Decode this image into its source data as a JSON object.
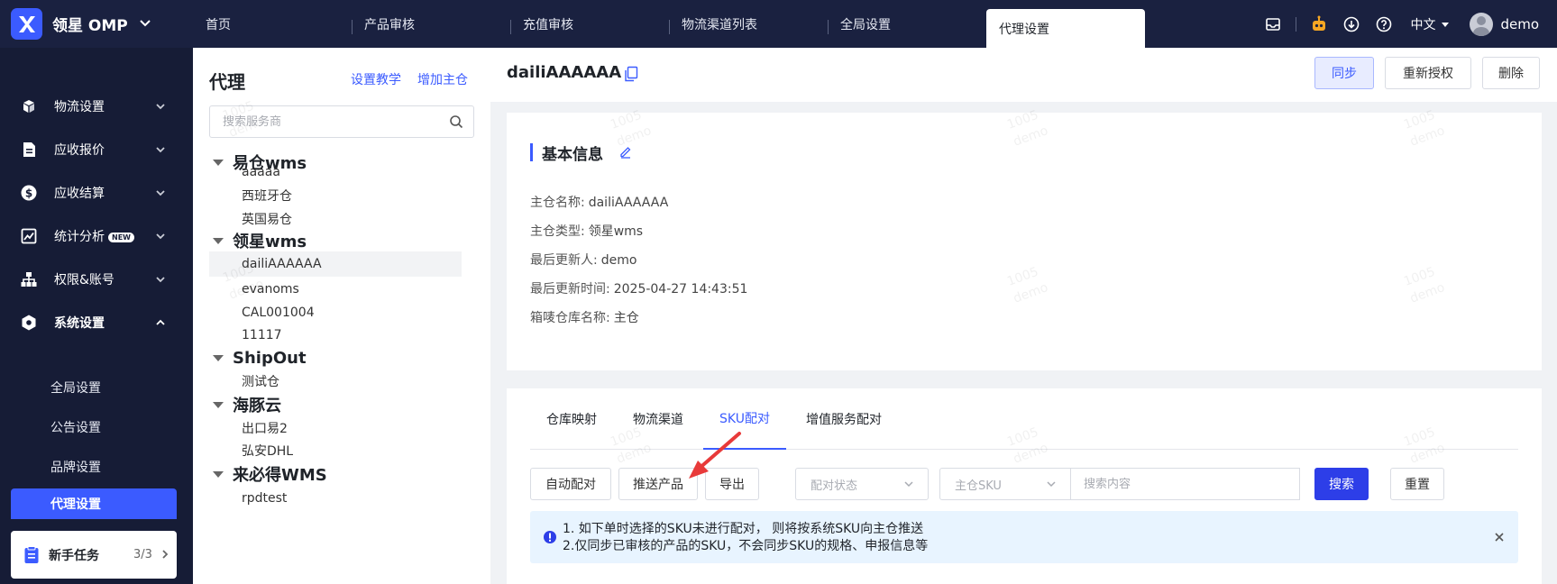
{
  "app": {
    "name": "领星 OMP"
  },
  "nav_tabs": [
    {
      "label": "首页"
    },
    {
      "label": "产品审核"
    },
    {
      "label": "充值审核"
    },
    {
      "label": "物流渠道列表"
    },
    {
      "label": "全局设置"
    },
    {
      "label": "代理设置",
      "active": true
    }
  ],
  "topbar": {
    "language": "中文",
    "username": "demo"
  },
  "sidebar": {
    "items": [
      {
        "label": "物流设置",
        "icon": "boxes-icon"
      },
      {
        "label": "应收报价",
        "icon": "document-icon"
      },
      {
        "label": "应收结算",
        "icon": "dollar-circle-icon"
      },
      {
        "label": "统计分析",
        "icon": "chart-icon",
        "badge": "NEW"
      },
      {
        "label": "权限&账号",
        "icon": "org-tree-icon"
      },
      {
        "label": "系统设置",
        "icon": "settings-hex-icon",
        "expanded": true
      }
    ],
    "sub_items": [
      {
        "label": "全局设置"
      },
      {
        "label": "公告设置"
      },
      {
        "label": "品牌设置"
      },
      {
        "label": "代理设置",
        "active": true
      }
    ],
    "newbie": {
      "label": "新手任务",
      "count": "3/3"
    }
  },
  "tree_panel": {
    "title": "代理",
    "tutorial_link": "设置教学",
    "add_link": "增加主仓",
    "search_placeholder": "搜索服务商",
    "groups": [
      {
        "label": "易仓wms",
        "children": [
          "aaaaa",
          "西班牙仓",
          "英国易仓"
        ]
      },
      {
        "label": "领星wms",
        "children": [
          "dailiAAAAAA",
          "evanoms",
          "CAL001004",
          "11117"
        ]
      },
      {
        "label": "ShipOut",
        "children": [
          "测试仓"
        ]
      },
      {
        "label": "海豚云",
        "children": [
          "出口易2",
          "弘安DHL"
        ]
      },
      {
        "label": "来必得WMS",
        "children": [
          "rpdtest"
        ]
      }
    ],
    "selected": "dailiAAAAAA"
  },
  "main": {
    "title": "dailiAAAAAA",
    "buttons": {
      "sync": "同步",
      "reauth": "重新授权",
      "delete": "删除"
    },
    "basic_info": {
      "title": "基本信息",
      "rows": [
        {
          "label": "主仓名称:",
          "value": "dailiAAAAAA"
        },
        {
          "label": "主仓类型:",
          "value": "领星wms"
        },
        {
          "label": "最后更新人:",
          "value": "demo"
        },
        {
          "label": "最后更新时间:",
          "value": "2025-04-27 14:43:51"
        },
        {
          "label": "箱唛仓库名称:",
          "value": "主仓"
        }
      ]
    },
    "tabs": [
      {
        "label": "仓库映射"
      },
      {
        "label": "物流渠道"
      },
      {
        "label": "SKU配对",
        "active": true
      },
      {
        "label": "增值服务配对"
      }
    ],
    "toolbar": {
      "auto_match": "自动配对",
      "push_product": "推送产品",
      "export": "导出",
      "match_status_placeholder": "配对状态",
      "sku_select": "主仓SKU",
      "search_placeholder": "搜索内容",
      "search": "搜索",
      "reset": "重置"
    },
    "notice": {
      "line1": "1. 如下单时选择的SKU未进行配对， 则将按系统SKU向主仓推送",
      "line2": "2.仅同步已审核的产品的SKU，不会同步SKU的规格、申报信息等"
    }
  },
  "watermark": {
    "line1": "1005",
    "line2": "demo"
  },
  "colors": {
    "topbar_bg": "#1a2140",
    "sidebar_bg": "#161c36",
    "accent": "#3b5bff",
    "primary_button": "#2d3ee8",
    "annotation_arrow": "#e83a3a"
  }
}
